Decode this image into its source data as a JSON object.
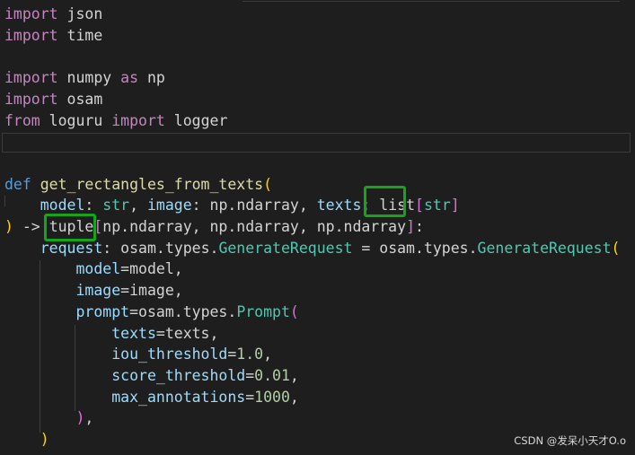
{
  "editor": {
    "language": "python",
    "colors": {
      "background": "#1e1e1e",
      "keyword_control": "#c586c0",
      "keyword_def": "#569cd6",
      "function": "#dcdcaa",
      "parameter": "#9cdcfe",
      "type": "#4ec9b0",
      "number": "#b5cea8",
      "text": "#d4d4d4",
      "bracket_gold": "#ffd700",
      "bracket_magenta": "#da70d6",
      "bracket_blue": "#179fff",
      "highlight_box": "#16a41c"
    },
    "lines": [
      [
        {
          "text": "import",
          "c": "#c586c0"
        },
        {
          "text": " json",
          "c": "#d4d4d4"
        }
      ],
      [
        {
          "text": "import",
          "c": "#c586c0"
        },
        {
          "text": " time",
          "c": "#d4d4d4"
        }
      ],
      [],
      [
        {
          "text": "import",
          "c": "#c586c0"
        },
        {
          "text": " numpy ",
          "c": "#d4d4d4"
        },
        {
          "text": "as",
          "c": "#c586c0"
        },
        {
          "text": " np",
          "c": "#d4d4d4"
        }
      ],
      [
        {
          "text": "import",
          "c": "#c586c0"
        },
        {
          "text": " osam",
          "c": "#d4d4d4"
        }
      ],
      [
        {
          "text": "from",
          "c": "#c586c0"
        },
        {
          "text": " loguru ",
          "c": "#d4d4d4"
        },
        {
          "text": "import",
          "c": "#c586c0"
        },
        {
          "text": " logger",
          "c": "#d4d4d4"
        }
      ],
      [],
      [],
      [
        {
          "text": "def",
          "c": "#569cd6"
        },
        {
          "text": " ",
          "c": "#d4d4d4"
        },
        {
          "text": "get_rectangles_from_texts",
          "c": "#dcdcaa"
        },
        {
          "text": "(",
          "c": "#ffd700"
        }
      ],
      [
        {
          "text": "    ",
          "c": "#d4d4d4"
        },
        {
          "text": "model",
          "c": "#9cdcfe"
        },
        {
          "text": ": ",
          "c": "#d4d4d4"
        },
        {
          "text": "str",
          "c": "#4ec9b0"
        },
        {
          "text": ", ",
          "c": "#d4d4d4"
        },
        {
          "text": "image",
          "c": "#9cdcfe"
        },
        {
          "text": ": np.ndarray, ",
          "c": "#d4d4d4"
        },
        {
          "text": "texts",
          "c": "#9cdcfe"
        },
        {
          "text": ": ",
          "c": "#d4d4d4"
        },
        {
          "text": "list",
          "c": "#d4d4d4"
        },
        {
          "text": "[",
          "c": "#da70d6"
        },
        {
          "text": "str",
          "c": "#4ec9b0"
        },
        {
          "text": "]",
          "c": "#da70d6"
        }
      ],
      [
        {
          "text": ")",
          "c": "#ffd700"
        },
        {
          "text": " -> ",
          "c": "#d4d4d4"
        },
        {
          "text": "tuple",
          "c": "#d4d4d4"
        },
        {
          "text": "[",
          "c": "#da70d6"
        },
        {
          "text": "np.ndarray, np.ndarray, np.ndarray",
          "c": "#d4d4d4"
        },
        {
          "text": "]",
          "c": "#da70d6"
        },
        {
          "text": ":",
          "c": "#d4d4d4"
        }
      ],
      [
        {
          "text": "    ",
          "c": "#d4d4d4"
        },
        {
          "text": "request",
          "c": "#9cdcfe"
        },
        {
          "text": ": osam.types.",
          "c": "#d4d4d4"
        },
        {
          "text": "GenerateRequest",
          "c": "#4ec9b0"
        },
        {
          "text": " = osam.types.",
          "c": "#d4d4d4"
        },
        {
          "text": "GenerateRequest",
          "c": "#4ec9b0"
        },
        {
          "text": "(",
          "c": "#ffd700"
        }
      ],
      [
        {
          "text": "        ",
          "c": "#d4d4d4"
        },
        {
          "text": "model",
          "c": "#9cdcfe"
        },
        {
          "text": "=model,",
          "c": "#d4d4d4"
        }
      ],
      [
        {
          "text": "        ",
          "c": "#d4d4d4"
        },
        {
          "text": "image",
          "c": "#9cdcfe"
        },
        {
          "text": "=image,",
          "c": "#d4d4d4"
        }
      ],
      [
        {
          "text": "        ",
          "c": "#d4d4d4"
        },
        {
          "text": "prompt",
          "c": "#9cdcfe"
        },
        {
          "text": "=osam.types.",
          "c": "#d4d4d4"
        },
        {
          "text": "Prompt",
          "c": "#4ec9b0"
        },
        {
          "text": "(",
          "c": "#da70d6"
        }
      ],
      [
        {
          "text": "            ",
          "c": "#d4d4d4"
        },
        {
          "text": "texts",
          "c": "#9cdcfe"
        },
        {
          "text": "=texts,",
          "c": "#d4d4d4"
        }
      ],
      [
        {
          "text": "            ",
          "c": "#d4d4d4"
        },
        {
          "text": "iou_threshold",
          "c": "#9cdcfe"
        },
        {
          "text": "=",
          "c": "#d4d4d4"
        },
        {
          "text": "1.0",
          "c": "#b5cea8"
        },
        {
          "text": ",",
          "c": "#d4d4d4"
        }
      ],
      [
        {
          "text": "            ",
          "c": "#d4d4d4"
        },
        {
          "text": "score_threshold",
          "c": "#9cdcfe"
        },
        {
          "text": "=",
          "c": "#d4d4d4"
        },
        {
          "text": "0.01",
          "c": "#b5cea8"
        },
        {
          "text": ",",
          "c": "#d4d4d4"
        }
      ],
      [
        {
          "text": "            ",
          "c": "#d4d4d4"
        },
        {
          "text": "max_annotations",
          "c": "#9cdcfe"
        },
        {
          "text": "=",
          "c": "#d4d4d4"
        },
        {
          "text": "1000",
          "c": "#b5cea8"
        },
        {
          "text": ",",
          "c": "#d4d4d4"
        }
      ],
      [
        {
          "text": "        ",
          "c": "#d4d4d4"
        },
        {
          "text": ")",
          "c": "#da70d6"
        },
        {
          "text": ",",
          "c": "#d4d4d4"
        }
      ],
      [
        {
          "text": "    ",
          "c": "#d4d4d4"
        },
        {
          "text": ")",
          "c": "#ffd700"
        }
      ]
    ]
  },
  "watermark": "CSDN @发呆小天才O.o"
}
